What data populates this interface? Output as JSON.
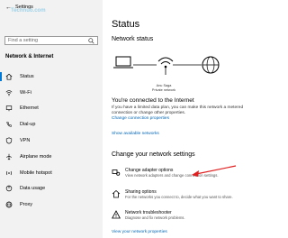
{
  "titlebar": {
    "title": "Settings"
  },
  "watermark": "Technuo.com",
  "sidebar": {
    "search_placeholder": "Find a setting",
    "section_title": "Network & Internet",
    "items": [
      {
        "label": "Status",
        "icon": "home-icon"
      },
      {
        "label": "Wi-Fi",
        "icon": "wifi-icon"
      },
      {
        "label": "Ethernet",
        "icon": "ethernet-icon"
      },
      {
        "label": "Dial-up",
        "icon": "phone-icon"
      },
      {
        "label": "VPN",
        "icon": "vpn-icon"
      },
      {
        "label": "Airplane mode",
        "icon": "airplane-icon"
      },
      {
        "label": "Mobile hotspot",
        "icon": "hotspot-icon"
      },
      {
        "label": "Data usage",
        "icon": "data-usage-icon"
      },
      {
        "label": "Proxy",
        "icon": "globe-icon"
      }
    ]
  },
  "main": {
    "title": "Status",
    "network_status_title": "Network status",
    "network_name_line1": "Anu Saga",
    "network_name_line2": "Private network",
    "connected_title": "You're connected to the Internet",
    "connected_desc": "If you have a limited data plan, you can make this network a metered connection or change other properties.",
    "link_change_props": "Change connection properties",
    "link_show_networks": "Show available networks",
    "change_settings_title": "Change your network settings",
    "options": [
      {
        "title": "Change adapter options",
        "desc": "View network adapters and change connection settings.",
        "icon": "adapter-icon"
      },
      {
        "title": "Sharing options",
        "desc": "For the networks you connect to, decide what you want to share.",
        "icon": "share-icon"
      },
      {
        "title": "Network troubleshooter",
        "desc": "Diagnose and fix network problems.",
        "icon": "warning-icon"
      }
    ],
    "link_view_props": "View your network properties"
  },
  "colors": {
    "accent": "#0078d7",
    "link": "#0066b4",
    "annotation_arrow": "#e02020"
  }
}
